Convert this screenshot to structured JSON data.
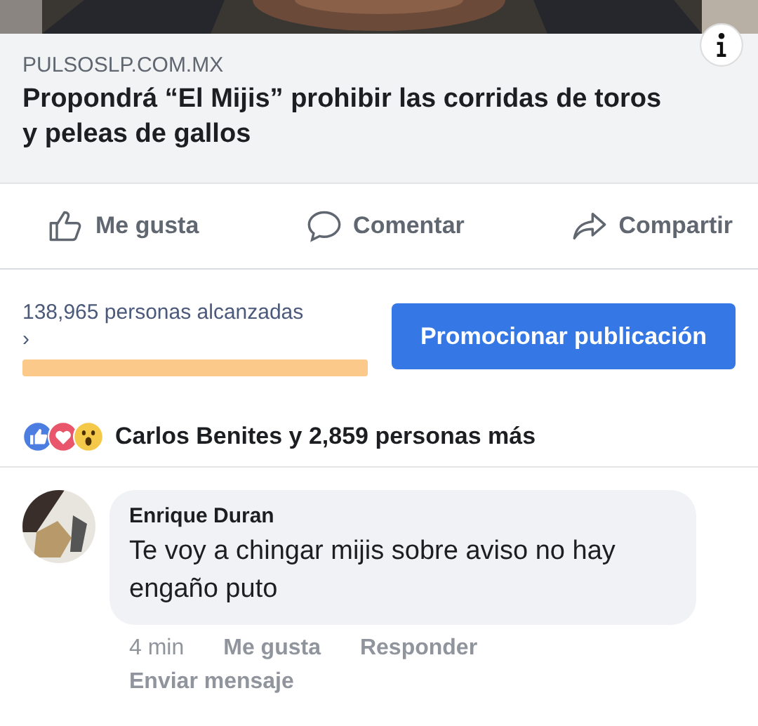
{
  "link_preview": {
    "domain": "PULSOSLP.COM.MX",
    "headline": "Propondrá “El Mijis” prohibir las corridas de toros y peleas de gallos"
  },
  "actions": [
    {
      "kind": "like",
      "label": "Me gusta"
    },
    {
      "kind": "comment",
      "label": "Comentar"
    },
    {
      "kind": "share",
      "label": "Compartir"
    }
  ],
  "reach": {
    "text": "138,965 personas alcanzadas",
    "chevron": "›",
    "button": "Promocionar publicación"
  },
  "reactions": {
    "icons": [
      {
        "kind": "like"
      },
      {
        "kind": "love"
      },
      {
        "kind": "wow"
      }
    ],
    "text": "Carlos Benites y 2,859 personas más"
  },
  "comment": {
    "author": "Enrique Duran",
    "text": "Te voy a chingar mijis sobre aviso no hay engaño puto",
    "time": "4 min",
    "actions": [
      "Me gusta",
      "Responder",
      "Enviar mensaje"
    ]
  }
}
